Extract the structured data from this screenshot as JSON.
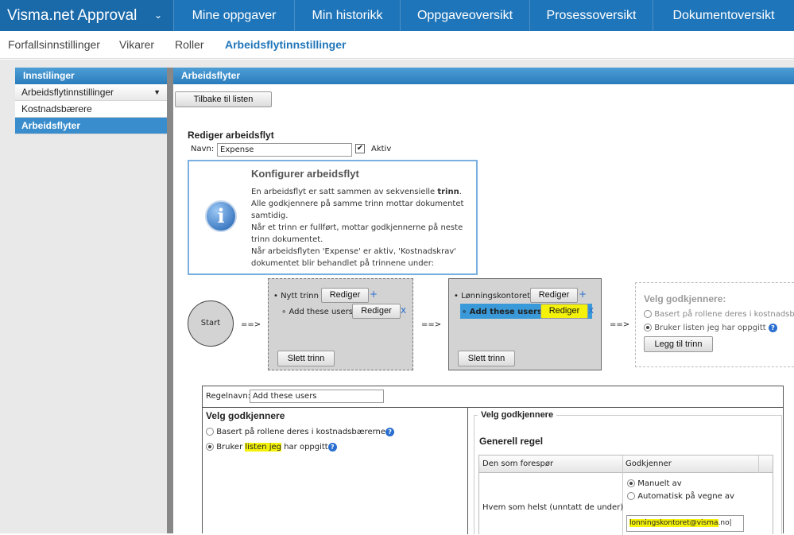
{
  "app": {
    "brand": "Visma.net Approval",
    "brand_chevron": "chevron-down-icon"
  },
  "nav": [
    "Mine oppgaver",
    "Min historikk",
    "Oppgaveoversikt",
    "Prosessoversikt",
    "Dokumentoversikt"
  ],
  "subnav": [
    "Forfallsinnstillinger",
    "Vikarer",
    "Roller",
    "Arbeidsflytinnstillinger"
  ],
  "sidebar": {
    "title": "Innstilinger",
    "dropdown": "Arbeidsflytinnstillinger",
    "items": [
      "Kostnadsbærere",
      "Arbeidsflyter"
    ]
  },
  "main": {
    "title": "Arbeidsflyter",
    "back_button": "Tilbake til listen",
    "edit_title": "Rediger arbeidsflyt",
    "name_label": "Navn:",
    "name_value": "Expense",
    "active_label": "Aktiv",
    "info": {
      "title": "Konfigurer arbeidsflyt",
      "line1": "En arbeidsflyt er satt sammen av sekvensielle ",
      "line1_bold": "trinn",
      "line1_end": ".",
      "line2": "Alle godkjennere på samme trinn mottar dokumentet",
      "line3": "samtidig.",
      "line4": "Når et trinn er fullført, mottar godkjennerne på neste",
      "line5": "trinn dokumentet.",
      "line6": "Når arbeidsflyten 'Expense' er aktiv, 'Kostnadskrav'",
      "line7": "dokumentet blir behandlet på trinnene under:"
    },
    "flow": {
      "start": "Start",
      "arrow": "==>",
      "step1": {
        "title": "Nytt trinn",
        "sub": "Add these users",
        "edit": "Rediger",
        "delete": "Slett trinn"
      },
      "step2": {
        "title": "Lønningskontoret",
        "sub": "Add these users",
        "edit": "Rediger",
        "delete": "Slett trinn"
      },
      "choose": {
        "title": "Velg godkjennere:",
        "opt1": "Basert på rollene deres i kostnadsba",
        "opt2": "Bruker listen jeg har oppgitt",
        "add": "Legg til trinn"
      }
    },
    "rule": {
      "name_label": "Regelnavn:",
      "name_value": "Add these users",
      "left_title": "Velg godkjennere",
      "opt1": "Basert på rollene deres i kostnadsbærerne",
      "opt2_a": "Bruker ",
      "opt2_hl": "listen jeg",
      "opt2_b": " har oppgitt",
      "right_legend": "Velg godkjennere",
      "general": "Generell regel",
      "col1": "Den som forespør",
      "col2": "Godkjenner",
      "row_label": "Hvem som helst (unntatt de under)",
      "manual": "Manuelt av",
      "auto": "Automatisk på vegne av",
      "email_hl": "lonningskontoret@visma",
      "email_rest": ".no"
    }
  }
}
